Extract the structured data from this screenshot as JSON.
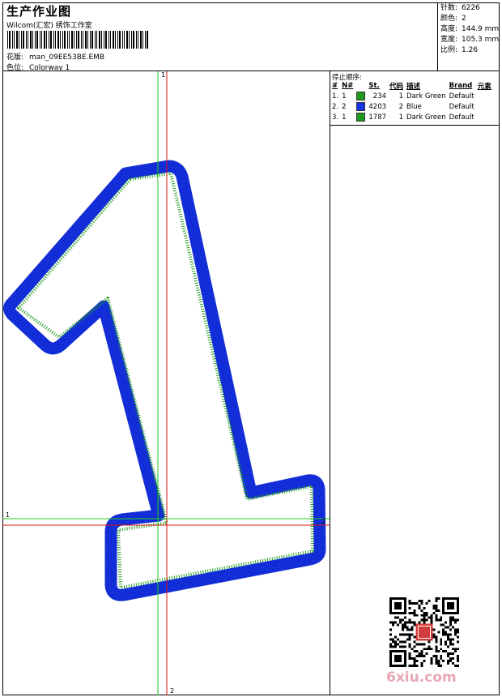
{
  "header": {
    "title": "生产作业图",
    "subtitle": "Wilcom(汇宏) 绣饰工作室",
    "design_label": "花版:",
    "design_value": "man_09EE53BE.EMB",
    "color_label": "色位:",
    "color_value": "Colorway 1"
  },
  "stats": [
    {
      "label": "针数:",
      "value": "6226"
    },
    {
      "label": "颜色:",
      "value": "2"
    },
    {
      "label": "高度:",
      "value": "144.9 mm"
    },
    {
      "label": "宽度:",
      "value": "105.3 mm"
    },
    {
      "label": "比例:",
      "value": "1.26"
    }
  ],
  "stop_sequence": {
    "title": "停止顺序:",
    "columns": [
      "#",
      "N#",
      "",
      "St.",
      "代码",
      "描述",
      "Brand",
      "元素"
    ],
    "rows": [
      {
        "idx": "1.",
        "n": "1",
        "color": "#1f9a1f",
        "st": "234",
        "code": "1",
        "desc": "Dark Green",
        "brand": "Default"
      },
      {
        "idx": "2.",
        "n": "2",
        "color": "#1633e8",
        "st": "4203",
        "code": "2",
        "desc": "Blue",
        "brand": "Default"
      },
      {
        "idx": "3.",
        "n": "1",
        "color": "#1f9a1f",
        "st": "1787",
        "code": "1",
        "desc": "Dark Green",
        "brand": "Default"
      }
    ]
  },
  "guides": {
    "green_v": "1",
    "green_h": "1",
    "red_v": "2",
    "red_h": "2"
  },
  "colors": {
    "thread_blue": "#1633e8",
    "thread_green": "#1f9a1f",
    "guide_green": "#22cc22",
    "guide_red": "#e01010"
  },
  "watermark": "6xiu.com",
  "icons": {
    "qr": "qr-code-icon"
  }
}
